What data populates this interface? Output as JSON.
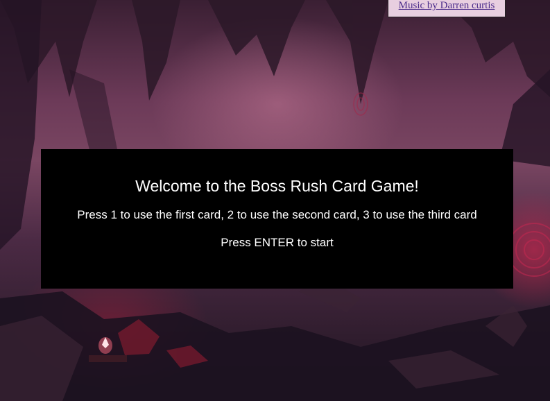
{
  "music_credit": {
    "label": "Music by Darren curtis"
  },
  "start_screen": {
    "title": "Welcome to the Boss Rush Card Game!",
    "instructions": "Press 1 to use the first card, 2 to use the second card, 3 to use the third card",
    "start_prompt": "Press ENTER to start"
  },
  "colors": {
    "dialog_background": "#000000",
    "dialog_text": "#ffffff",
    "link": "#4a2a8a",
    "link_box": "#e8cfe0"
  }
}
